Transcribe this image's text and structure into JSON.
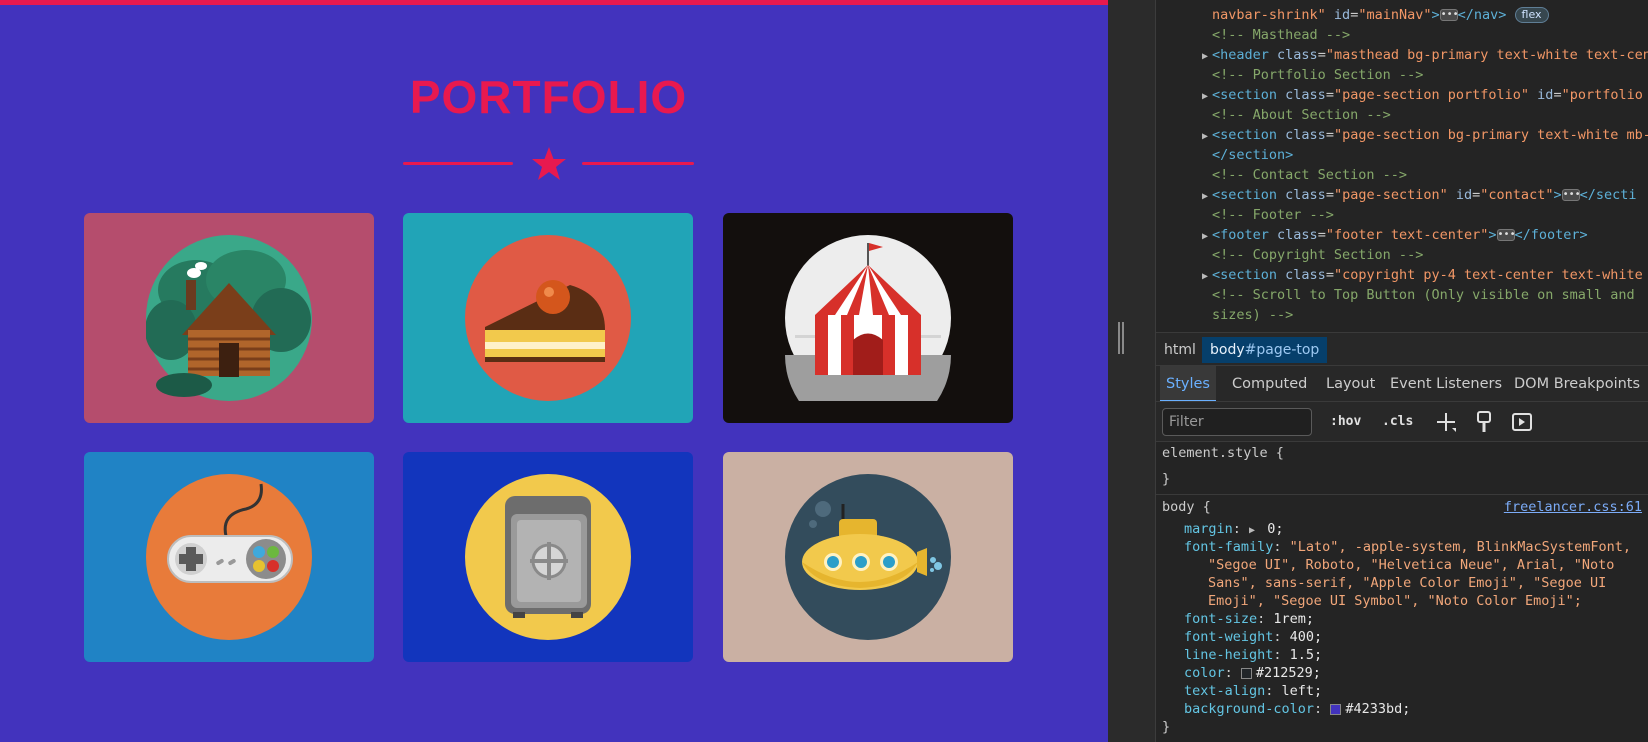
{
  "page": {
    "title": "PORTFOLIO",
    "tiles": [
      {
        "name": "cabin",
        "bg": "#b54d6d",
        "circle": "#3aa889"
      },
      {
        "name": "cake",
        "bg": "#21a4b7",
        "circle": "#e05a45"
      },
      {
        "name": "circus",
        "bg": "#130f0d",
        "circle": "#ededed"
      },
      {
        "name": "game-controller",
        "bg": "#2083c5",
        "circle": "#e87b3a"
      },
      {
        "name": "safe",
        "bg": "#1235bd",
        "circle": "#f2c94c"
      },
      {
        "name": "submarine",
        "bg": "#cab0a3",
        "circle": "#334c5c"
      }
    ],
    "colors": {
      "background": "#4233bd",
      "accent": "#e8194f"
    }
  },
  "devtools": {
    "dom": {
      "line0_part1": "navbar-shrink\" ",
      "line0_id_attr": "id",
      "line0_id_val": "\"mainNav\"",
      "line0_close": "</nav>",
      "flex_badge": "flex",
      "comment_masthead": "<!-- Masthead -->",
      "header_tag": "<header",
      "header_class_val": "\"masthead bg-primary text-white text-cen",
      "comment_portfolio": "<!-- Portfolio Section -->",
      "section1_class_val": "\"page-section portfolio\"",
      "section1_id_val": "\"portfolio",
      "comment_about": "<!-- About Section -->",
      "section2_class_val": "\"page-section bg-primary text-white mb-",
      "section_close": "</section>",
      "comment_contact": "<!-- Contact Section -->",
      "section3_class_val": "\"page-section\"",
      "section3_id_val": "\"contact\"",
      "section3_close": "</secti",
      "comment_footer": "<!-- Footer -->",
      "footer_class_val": "\"footer text-center\"",
      "footer_close": "</footer>",
      "comment_copyright": "<!-- Copyright Section -->",
      "section4_class_val": "\"copyright py-4 text-center text-white",
      "comment_scroll_a": "<!-- Scroll to Top Button (Only visible on small and",
      "comment_scroll_b": "sizes) -->",
      "attr_class": "class",
      "attr_id": "id",
      "tag_section": "<section"
    },
    "breadcrumbs": {
      "html": "html",
      "body_tag": "body",
      "body_id": "#page-top"
    },
    "tabs": [
      "Styles",
      "Computed",
      "Layout",
      "Event Listeners",
      "DOM Breakpoints"
    ],
    "toolbar": {
      "filter_placeholder": "Filter",
      "hov": ":hov",
      "cls": ".cls"
    },
    "styles": {
      "element_style_open": "element.style {",
      "close_brace": "}",
      "body_selector": "body {",
      "source_link": "freelancer.css:61",
      "margin_prop": "margin",
      "margin_val": "0;",
      "font_family_prop": "font-family",
      "font_family_val_1": "\"Lato\", -apple-system, BlinkMacSystemFont,",
      "font_family_val_2": "\"Segoe UI\", Roboto, \"Helvetica Neue\", Arial, \"Noto",
      "font_family_val_3": "Sans\", sans-serif, \"Apple Color Emoji\", \"Segoe UI",
      "font_family_val_4": "Emoji\", \"Segoe UI Symbol\", \"Noto Color Emoji\";",
      "font_size_prop": "font-size",
      "font_size_val": "1rem;",
      "font_weight_prop": "font-weight",
      "font_weight_val": "400;",
      "line_height_prop": "line-height",
      "line_height_val": "1.5;",
      "color_prop": "color",
      "color_val": "#212529;",
      "color_swatch": "#212529",
      "text_align_prop": "text-align",
      "text_align_val": "left;",
      "bg_prop": "background-color",
      "bg_val": "#4233bd;",
      "bg_swatch": "#4233bd"
    }
  }
}
